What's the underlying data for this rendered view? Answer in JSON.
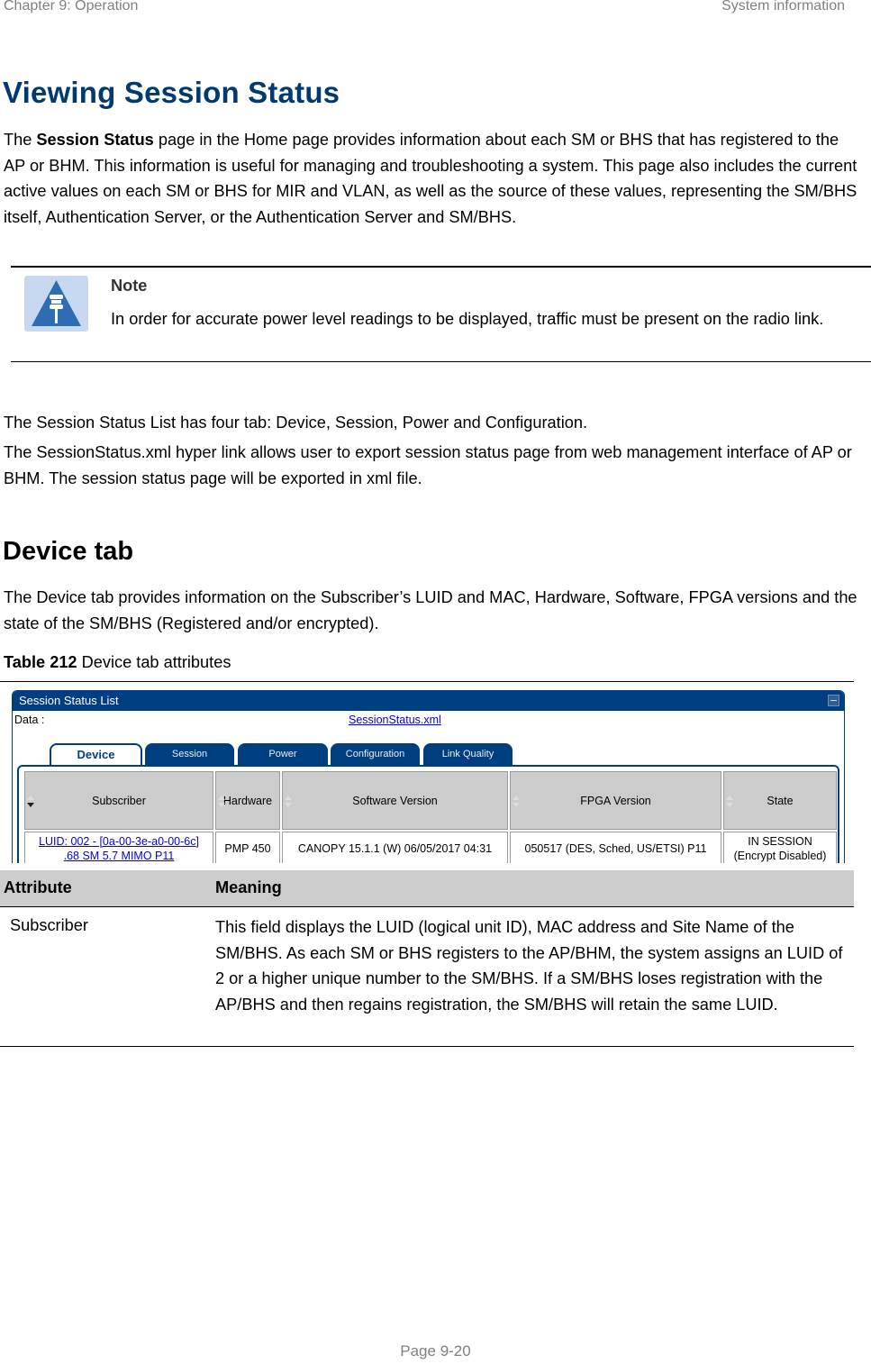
{
  "header": {
    "chapter": "Chapter 9:  Operation",
    "section": "System information"
  },
  "title": "Viewing Session Status",
  "intro": {
    "prefix": "The ",
    "bold": "Session Status",
    "rest": " page in the Home page provides information about each SM or BHS that has registered to the AP or BHM. This information is useful for managing and troubleshooting a system. This page also includes the current active values on each SM or BHS for MIR and VLAN, as well as the source of these values, representing the SM/BHS itself, Authentication Server, or the Authentication Server and SM/BHS."
  },
  "note": {
    "icon": "note-pin-icon",
    "title": "Note",
    "text": "In order for accurate power level readings to be displayed, traffic must be present on the radio link."
  },
  "paragraphs": {
    "tabs_info": "The Session Status List has four tab: Device, Session, Power and Configuration.",
    "export_info": "The SessionStatus.xml hyper link allows user to export session status page from web management interface of AP or BHM. The session status page will be exported in xml file."
  },
  "device_tab": {
    "heading": "Device tab",
    "description": "The Device tab provides information on the Subscriber’s LUID and MAC, Hardware, Software, FPGA versions and the state of the SM/BHS (Registered and/or encrypted).",
    "caption_bold": "Table 212",
    "caption_text": " Device tab attributes"
  },
  "screenshot": {
    "panel_title": "Session Status List",
    "data_label": "Data :",
    "data_link": "SessionStatus.xml",
    "tabs": [
      {
        "label": "Device",
        "active": true
      },
      {
        "label": "Session",
        "active": false
      },
      {
        "label": "Power",
        "active": false
      },
      {
        "label": "Configuration",
        "active": false
      },
      {
        "label": "Link Quality",
        "active": false
      }
    ],
    "columns": [
      "Subscriber",
      "Hardware",
      "Software Version",
      "FPGA Version",
      "State"
    ],
    "rows": [
      {
        "subscriber_line1": "LUID: 002 - [0a-00-3e-a0-00-6c]",
        "subscriber_line2": ".68 SM 5.7 MIMO P11",
        "hardware": "PMP 450",
        "software": "CANOPY 15.1.1 (W) 06/05/2017 04:31",
        "fpga": "050517 (DES, Sched, US/ETSI) P11",
        "state_line1": "IN SESSION",
        "state_line2": "(Encrypt Disabled)"
      }
    ]
  },
  "attributes_table": {
    "headers": [
      "Attribute",
      "Meaning"
    ],
    "rows": [
      {
        "attribute": "Subscriber",
        "meaning": "This field displays the LUID (logical unit ID), MAC address and Site Name of the SM/BHS. As each SM or BHS registers to the AP/BHM, the system assigns an LUID of 2 or a higher unique number to the SM/BHS. If a SM/BHS loses registration with the AP/BHS and then regains registration, the SM/BHS will retain the same LUID."
      }
    ]
  },
  "footer": {
    "page": "Page 9-20"
  }
}
